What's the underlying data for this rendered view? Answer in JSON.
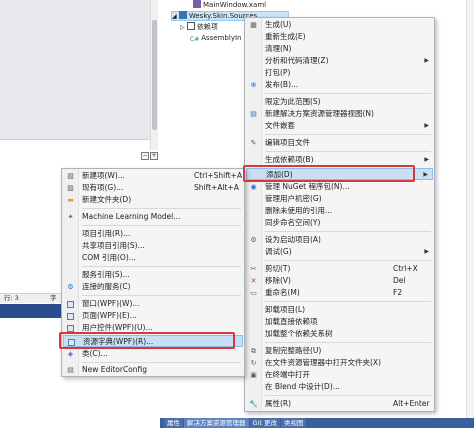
{
  "colors": {
    "accent": "#1e6fd2",
    "highlight": "#c9dff5",
    "annotation_red": "#d9383a",
    "tab_bar": "#3b5f9a"
  },
  "editor": {
    "status_line": "行: 3",
    "status_char": "字符"
  },
  "solution_tree": {
    "items": [
      {
        "label": "MainWindow.xaml",
        "icon": "xaml-file-icon"
      },
      {
        "label": "Wesky.Skin.Sources",
        "icon": "project-icon"
      },
      {
        "label": "依赖项",
        "icon": "dependencies-icon"
      },
      {
        "label": "AssemblyIn",
        "icon": "csharp-file-icon"
      }
    ]
  },
  "bottom_tabs": [
    "属性",
    "解决方案资源管理器",
    "Git 更改",
    "类视图"
  ],
  "main_menu": {
    "items": [
      {
        "label": "生成(U)",
        "icon": "build-icon"
      },
      {
        "label": "重新生成(E)",
        "icon": ""
      },
      {
        "label": "清理(N)",
        "icon": ""
      },
      {
        "label": "分析和代码清理(Z)",
        "icon": "",
        "submenu": true
      },
      {
        "label": "打包(P)",
        "icon": ""
      },
      {
        "label": "发布(B)...",
        "icon": "publish-icon"
      },
      {
        "label": "限定为此范围(S)",
        "icon": ""
      },
      {
        "label": "新建解决方案资源管理器视图(N)",
        "icon": "new-view-icon"
      },
      {
        "label": "文件嵌套",
        "icon": "",
        "submenu": true
      },
      {
        "label": "编辑项目文件",
        "icon": "edit-file-icon"
      },
      {
        "label": "生成依赖项(B)",
        "icon": "",
        "submenu": true
      },
      {
        "label": "添加(D)",
        "icon": "",
        "submenu": true,
        "highlighted": true
      },
      {
        "label": "管理 NuGet 程序包(N)...",
        "icon": "nuget-icon"
      },
      {
        "label": "管理用户机密(G)",
        "icon": ""
      },
      {
        "label": "删除未使用的引用...",
        "icon": ""
      },
      {
        "label": "同步命名空间(Y)",
        "icon": ""
      },
      {
        "label": "设为启动项目(A)",
        "icon": "gear-icon"
      },
      {
        "label": "调试(G)",
        "icon": "",
        "submenu": true
      },
      {
        "label": "剪切(T)",
        "shortcut": "Ctrl+X",
        "icon": "cut-icon"
      },
      {
        "label": "移除(V)",
        "shortcut": "Del",
        "icon": "remove-icon"
      },
      {
        "label": "重命名(M)",
        "shortcut": "F2",
        "icon": "rename-icon"
      },
      {
        "label": "卸载项目(L)",
        "icon": ""
      },
      {
        "label": "加载直接依赖项",
        "icon": ""
      },
      {
        "label": "加载整个依赖关系树",
        "icon": ""
      },
      {
        "label": "复制完整路径(U)",
        "icon": "copy-path-icon"
      },
      {
        "label": "在文件资源管理器中打开文件夹(X)",
        "icon": "open-folder-icon"
      },
      {
        "label": "在终端中打开",
        "icon": "terminal-icon"
      },
      {
        "label": "在 Blend 中设计(D)...",
        "icon": ""
      },
      {
        "label": "属性(R)",
        "shortcut": "Alt+Enter",
        "icon": "properties-icon"
      }
    ]
  },
  "add_menu": {
    "items": [
      {
        "label": "新建项(W)...",
        "shortcut": "Ctrl+Shift+A",
        "icon": "new-item-icon"
      },
      {
        "label": "现有项(G)...",
        "shortcut": "Shift+Alt+A",
        "icon": "existing-item-icon"
      },
      {
        "label": "新建文件夹(D)",
        "icon": "new-folder-icon"
      },
      {
        "label": "Machine Learning Model...",
        "icon": "ml-model-icon"
      },
      {
        "label": "项目引用(R)...",
        "icon": ""
      },
      {
        "label": "共享项目引用(S)...",
        "icon": ""
      },
      {
        "label": "COM 引用(O)...",
        "icon": ""
      },
      {
        "label": "服务引用(S)...",
        "icon": ""
      },
      {
        "label": "连接的服务(C)",
        "icon": "connected-service-icon"
      },
      {
        "label": "窗口(WPF)(W)...",
        "icon": "window-icon"
      },
      {
        "label": "页面(WPF)(E)...",
        "icon": "page-icon"
      },
      {
        "label": "用户控件(WPF)(U)...",
        "icon": "user-control-icon"
      },
      {
        "label": "资源字典(WPF)(R)...",
        "icon": "resource-dictionary-icon",
        "highlighted": true
      },
      {
        "label": "类(C)...",
        "icon": "class-icon"
      },
      {
        "label": "New EditorConfig",
        "icon": "editorconfig-icon"
      }
    ]
  }
}
